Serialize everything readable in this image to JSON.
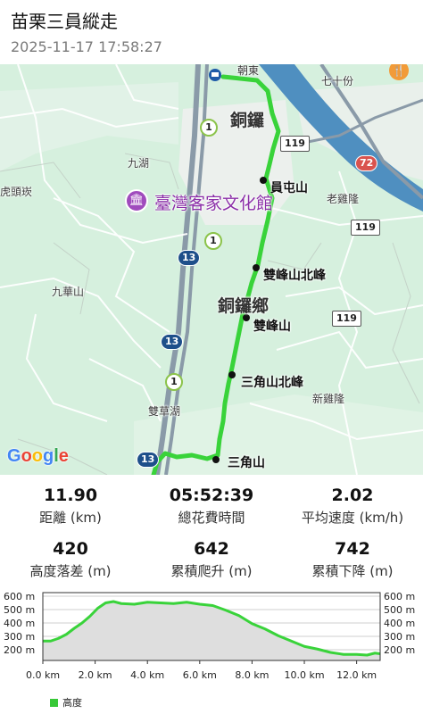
{
  "header": {
    "title": "苗栗三員縱走",
    "timestamp": "2025-11-17 17:58:27"
  },
  "map": {
    "labels": {
      "chaodong": "朝東",
      "qishifen": "七十份",
      "tongluo": "銅鑼",
      "jiuhu": "九湖",
      "laojilong": "老雞隆",
      "hutoukeng": "虎頭崁",
      "hakka_museum": "臺灣客家文化館",
      "jiuhuashan": "九華山",
      "tongluo_township": "銅鑼鄉",
      "xinjilong": "新雞隆",
      "shuangcaohu": "雙草湖"
    },
    "peaks": {
      "yuantun": "員屯山",
      "shuangfeng_north": "雙峰山北峰",
      "shuangfeng": "雙峰山",
      "sanjiao_north": "三角山北峰",
      "sanjiao": "三角山"
    },
    "roads": {
      "r119a": "119",
      "r119b": "119",
      "r119c": "119",
      "r72": "72",
      "r13a": "13",
      "r13b": "13",
      "r13c": "13",
      "r1a": "1",
      "r1b": "1",
      "r1c": "1"
    },
    "attribution": "Google",
    "colors": {
      "track": "#39d33a",
      "map_bg": "#d6f0de",
      "river": "#4f8fc0"
    }
  },
  "stats": [
    {
      "value": "11.90",
      "label": "距離 (km)"
    },
    {
      "value": "05:52:39",
      "label": "總花費時間"
    },
    {
      "value": "2.02",
      "label": "平均速度 (km/h)"
    },
    {
      "value": "420",
      "label": "高度落差 (m)"
    },
    {
      "value": "642",
      "label": "累積爬升 (m)"
    },
    {
      "value": "742",
      "label": "累積下降 (m)"
    }
  ],
  "elevation_chart": {
    "y_ticks": [
      "600 m",
      "500 m",
      "400 m",
      "300 m",
      "200 m"
    ],
    "x_ticks": [
      "0.0 km",
      "2.0 km",
      "4.0 km",
      "6.0 km",
      "8.0 km",
      "10.0 km",
      "12.0 km"
    ],
    "legend": "高度"
  },
  "chart_data": {
    "type": "area",
    "title": "",
    "xlabel": "",
    "ylabel": "",
    "xlim": [
      0,
      12.9
    ],
    "ylim": [
      120,
      600
    ],
    "series": [
      {
        "name": "高度",
        "x": [
          0,
          0.3,
          0.6,
          0.9,
          1.2,
          1.5,
          1.8,
          2.1,
          2.4,
          2.7,
          3.0,
          3.5,
          4.0,
          4.5,
          5.0,
          5.5,
          6.0,
          6.5,
          7.0,
          7.5,
          8.0,
          8.5,
          9.0,
          9.5,
          10.0,
          10.5,
          11.0,
          11.5,
          12.0,
          12.4,
          12.7,
          12.9
        ],
        "y": [
          265,
          265,
          285,
          315,
          360,
          400,
          450,
          510,
          550,
          560,
          545,
          540,
          555,
          550,
          545,
          555,
          540,
          530,
          495,
          455,
          395,
          355,
          305,
          265,
          225,
          205,
          180,
          165,
          165,
          160,
          175,
          170
        ]
      }
    ],
    "grid": true,
    "legend_position": "bottom-left"
  }
}
